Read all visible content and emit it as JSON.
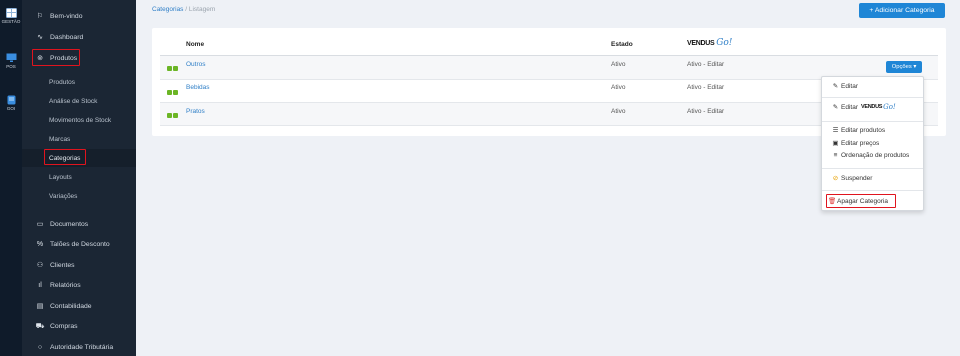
{
  "rail": {
    "items": [
      {
        "label": "GESTÃO",
        "icon": "grid-icon"
      },
      {
        "label": "POS",
        "icon": "monitor-icon"
      },
      {
        "label": "GOI",
        "icon": "tablet-icon"
      }
    ]
  },
  "sidebar": {
    "items": [
      {
        "label": "Bem-vindo",
        "icon": "flag-icon"
      },
      {
        "label": "Dashboard",
        "icon": "activity-icon"
      },
      {
        "label": "Produtos",
        "icon": "box-icon"
      }
    ],
    "sub_items": [
      {
        "label": "Produtos"
      },
      {
        "label": "Análise de Stock"
      },
      {
        "label": "Movimentos de Stock"
      },
      {
        "label": "Marcas"
      },
      {
        "label": "Categorias"
      },
      {
        "label": "Layouts"
      },
      {
        "label": "Variações"
      }
    ],
    "lower_items": [
      {
        "label": "Documentos",
        "icon": "folder-icon"
      },
      {
        "label": "Talões de Desconto",
        "icon": "percent-icon"
      },
      {
        "label": "Clientes",
        "icon": "users-icon"
      },
      {
        "label": "Relatórios",
        "icon": "bar-chart-icon"
      },
      {
        "label": "Contabilidade",
        "icon": "file-icon"
      },
      {
        "label": "Compras",
        "icon": "truck-icon"
      },
      {
        "label": "Autoridade Tributária",
        "icon": "circle-icon"
      }
    ]
  },
  "breadcrumb": {
    "link": "Categorias",
    "sep": "/",
    "current": "Listagem"
  },
  "header": {
    "add_button": "+ Adicionar Categoria"
  },
  "table": {
    "headers": {
      "name": "Nome",
      "state": "Estado",
      "vendus": "VENDUS",
      "vendus_go": "Go!"
    },
    "rows": [
      {
        "name": "Outros",
        "state": "Ativo",
        "vendus": "Ativo - Editar"
      },
      {
        "name": "Bebidas",
        "state": "Ativo",
        "vendus": "Ativo - Editar"
      },
      {
        "name": "Pratos",
        "state": "Ativo",
        "vendus": "Ativo - Editar"
      }
    ]
  },
  "options_button": "Opções ▾",
  "menu": {
    "edit": "Editar",
    "edit_vendus": "Editar",
    "vendus_logo": "VENDUS",
    "vendus_go": "Go!",
    "edit_products": "Editar produtos",
    "edit_prices": "Editar preços",
    "order_products": "Ordenação de produtos",
    "suspend": "Suspender",
    "delete": "Apagar Categoria"
  },
  "colors": {
    "accent": "#1f86d6",
    "sidebar": "#1b2634",
    "highlight": "#e0141e",
    "toggle_green": "#6bb525"
  }
}
